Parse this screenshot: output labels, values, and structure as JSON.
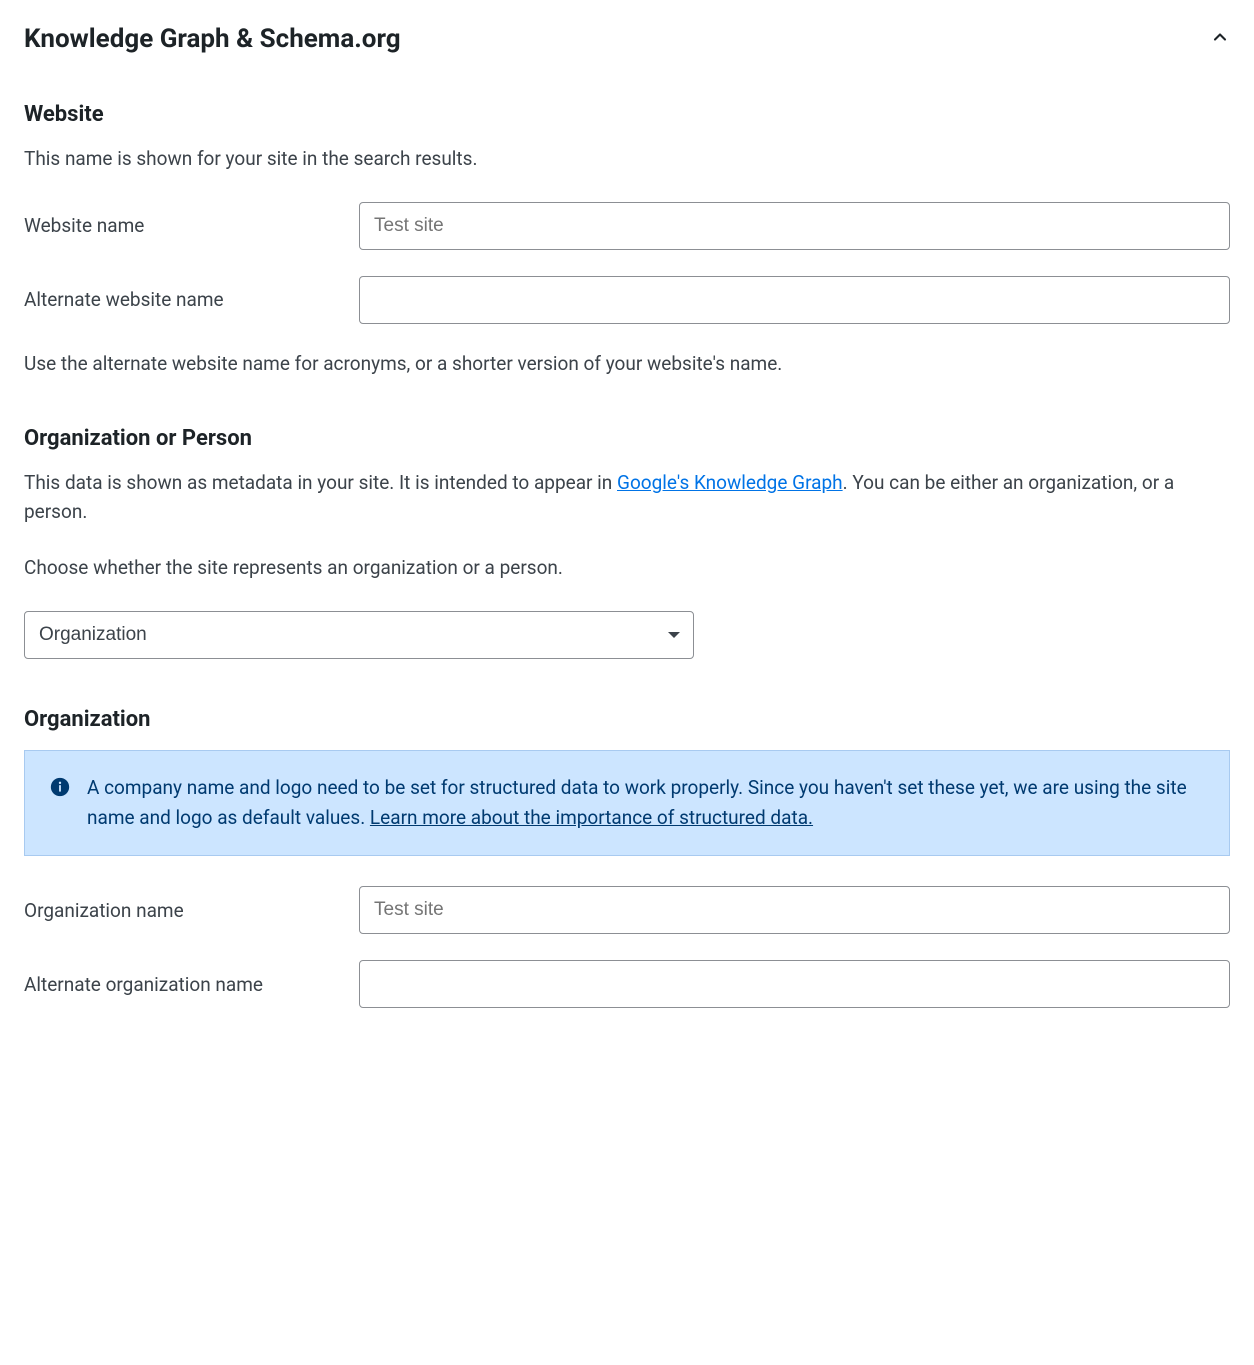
{
  "header": {
    "title": "Knowledge Graph & Schema.org"
  },
  "website": {
    "heading": "Website",
    "description": "This name is shown for your site in the search results.",
    "name_label": "Website name",
    "name_placeholder": "Test site",
    "name_value": "",
    "alt_name_label": "Alternate website name",
    "alt_name_value": "",
    "help_text": "Use the alternate website name for acronyms, or a shorter version of your website's name."
  },
  "org_person": {
    "heading": "Organization or Person",
    "description_pre": "This data is shown as metadata in your site. It is intended to appear in ",
    "link_text": "Google's Knowledge Graph",
    "description_post": ". You can be either an organization, or a person.",
    "choose_text": "Choose whether the site represents an organization or a person.",
    "select_value": "Organization"
  },
  "organization": {
    "heading": "Organization",
    "info_text_pre": "A company name and logo need to be set for structured data to work properly. Since you haven't set these yet, we are using the site name and logo as default values. ",
    "info_link_text": "Learn more about the importance of structured data.",
    "name_label": "Organization name",
    "name_placeholder": "Test site",
    "name_value": "",
    "alt_name_label": "Alternate organization name",
    "alt_name_value": ""
  }
}
